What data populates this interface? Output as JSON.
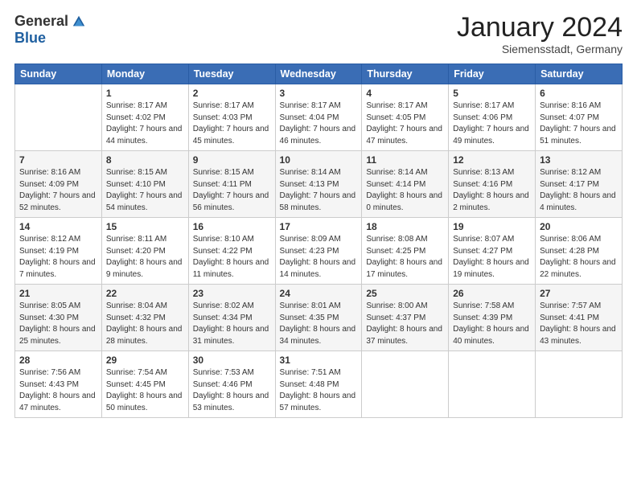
{
  "logo": {
    "general": "General",
    "blue": "Blue"
  },
  "title": "January 2024",
  "location": "Siemensstadt, Germany",
  "days_of_week": [
    "Sunday",
    "Monday",
    "Tuesday",
    "Wednesday",
    "Thursday",
    "Friday",
    "Saturday"
  ],
  "weeks": [
    [
      {
        "day": "",
        "sunrise": "",
        "sunset": "",
        "daylight": ""
      },
      {
        "day": "1",
        "sunrise": "Sunrise: 8:17 AM",
        "sunset": "Sunset: 4:02 PM",
        "daylight": "Daylight: 7 hours and 44 minutes."
      },
      {
        "day": "2",
        "sunrise": "Sunrise: 8:17 AM",
        "sunset": "Sunset: 4:03 PM",
        "daylight": "Daylight: 7 hours and 45 minutes."
      },
      {
        "day": "3",
        "sunrise": "Sunrise: 8:17 AM",
        "sunset": "Sunset: 4:04 PM",
        "daylight": "Daylight: 7 hours and 46 minutes."
      },
      {
        "day": "4",
        "sunrise": "Sunrise: 8:17 AM",
        "sunset": "Sunset: 4:05 PM",
        "daylight": "Daylight: 7 hours and 47 minutes."
      },
      {
        "day": "5",
        "sunrise": "Sunrise: 8:17 AM",
        "sunset": "Sunset: 4:06 PM",
        "daylight": "Daylight: 7 hours and 49 minutes."
      },
      {
        "day": "6",
        "sunrise": "Sunrise: 8:16 AM",
        "sunset": "Sunset: 4:07 PM",
        "daylight": "Daylight: 7 hours and 51 minutes."
      }
    ],
    [
      {
        "day": "7",
        "sunrise": "Sunrise: 8:16 AM",
        "sunset": "Sunset: 4:09 PM",
        "daylight": "Daylight: 7 hours and 52 minutes."
      },
      {
        "day": "8",
        "sunrise": "Sunrise: 8:15 AM",
        "sunset": "Sunset: 4:10 PM",
        "daylight": "Daylight: 7 hours and 54 minutes."
      },
      {
        "day": "9",
        "sunrise": "Sunrise: 8:15 AM",
        "sunset": "Sunset: 4:11 PM",
        "daylight": "Daylight: 7 hours and 56 minutes."
      },
      {
        "day": "10",
        "sunrise": "Sunrise: 8:14 AM",
        "sunset": "Sunset: 4:13 PM",
        "daylight": "Daylight: 7 hours and 58 minutes."
      },
      {
        "day": "11",
        "sunrise": "Sunrise: 8:14 AM",
        "sunset": "Sunset: 4:14 PM",
        "daylight": "Daylight: 8 hours and 0 minutes."
      },
      {
        "day": "12",
        "sunrise": "Sunrise: 8:13 AM",
        "sunset": "Sunset: 4:16 PM",
        "daylight": "Daylight: 8 hours and 2 minutes."
      },
      {
        "day": "13",
        "sunrise": "Sunrise: 8:12 AM",
        "sunset": "Sunset: 4:17 PM",
        "daylight": "Daylight: 8 hours and 4 minutes."
      }
    ],
    [
      {
        "day": "14",
        "sunrise": "Sunrise: 8:12 AM",
        "sunset": "Sunset: 4:19 PM",
        "daylight": "Daylight: 8 hours and 7 minutes."
      },
      {
        "day": "15",
        "sunrise": "Sunrise: 8:11 AM",
        "sunset": "Sunset: 4:20 PM",
        "daylight": "Daylight: 8 hours and 9 minutes."
      },
      {
        "day": "16",
        "sunrise": "Sunrise: 8:10 AM",
        "sunset": "Sunset: 4:22 PM",
        "daylight": "Daylight: 8 hours and 11 minutes."
      },
      {
        "day": "17",
        "sunrise": "Sunrise: 8:09 AM",
        "sunset": "Sunset: 4:23 PM",
        "daylight": "Daylight: 8 hours and 14 minutes."
      },
      {
        "day": "18",
        "sunrise": "Sunrise: 8:08 AM",
        "sunset": "Sunset: 4:25 PM",
        "daylight": "Daylight: 8 hours and 17 minutes."
      },
      {
        "day": "19",
        "sunrise": "Sunrise: 8:07 AM",
        "sunset": "Sunset: 4:27 PM",
        "daylight": "Daylight: 8 hours and 19 minutes."
      },
      {
        "day": "20",
        "sunrise": "Sunrise: 8:06 AM",
        "sunset": "Sunset: 4:28 PM",
        "daylight": "Daylight: 8 hours and 22 minutes."
      }
    ],
    [
      {
        "day": "21",
        "sunrise": "Sunrise: 8:05 AM",
        "sunset": "Sunset: 4:30 PM",
        "daylight": "Daylight: 8 hours and 25 minutes."
      },
      {
        "day": "22",
        "sunrise": "Sunrise: 8:04 AM",
        "sunset": "Sunset: 4:32 PM",
        "daylight": "Daylight: 8 hours and 28 minutes."
      },
      {
        "day": "23",
        "sunrise": "Sunrise: 8:02 AM",
        "sunset": "Sunset: 4:34 PM",
        "daylight": "Daylight: 8 hours and 31 minutes."
      },
      {
        "day": "24",
        "sunrise": "Sunrise: 8:01 AM",
        "sunset": "Sunset: 4:35 PM",
        "daylight": "Daylight: 8 hours and 34 minutes."
      },
      {
        "day": "25",
        "sunrise": "Sunrise: 8:00 AM",
        "sunset": "Sunset: 4:37 PM",
        "daylight": "Daylight: 8 hours and 37 minutes."
      },
      {
        "day": "26",
        "sunrise": "Sunrise: 7:58 AM",
        "sunset": "Sunset: 4:39 PM",
        "daylight": "Daylight: 8 hours and 40 minutes."
      },
      {
        "day": "27",
        "sunrise": "Sunrise: 7:57 AM",
        "sunset": "Sunset: 4:41 PM",
        "daylight": "Daylight: 8 hours and 43 minutes."
      }
    ],
    [
      {
        "day": "28",
        "sunrise": "Sunrise: 7:56 AM",
        "sunset": "Sunset: 4:43 PM",
        "daylight": "Daylight: 8 hours and 47 minutes."
      },
      {
        "day": "29",
        "sunrise": "Sunrise: 7:54 AM",
        "sunset": "Sunset: 4:45 PM",
        "daylight": "Daylight: 8 hours and 50 minutes."
      },
      {
        "day": "30",
        "sunrise": "Sunrise: 7:53 AM",
        "sunset": "Sunset: 4:46 PM",
        "daylight": "Daylight: 8 hours and 53 minutes."
      },
      {
        "day": "31",
        "sunrise": "Sunrise: 7:51 AM",
        "sunset": "Sunset: 4:48 PM",
        "daylight": "Daylight: 8 hours and 57 minutes."
      },
      {
        "day": "",
        "sunrise": "",
        "sunset": "",
        "daylight": ""
      },
      {
        "day": "",
        "sunrise": "",
        "sunset": "",
        "daylight": ""
      },
      {
        "day": "",
        "sunrise": "",
        "sunset": "",
        "daylight": ""
      }
    ]
  ]
}
